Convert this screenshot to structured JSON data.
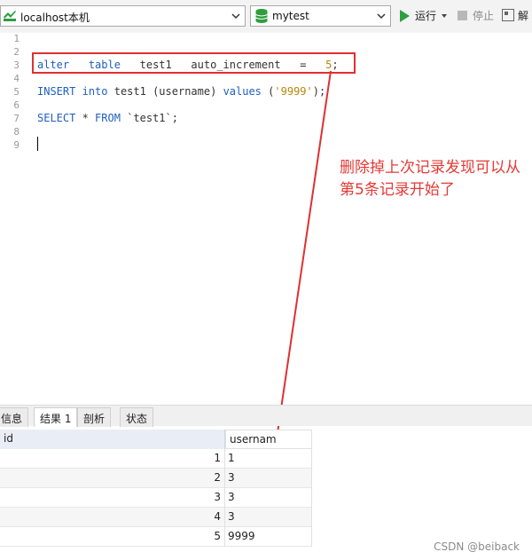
{
  "toolbar": {
    "connection": "localhost本机",
    "database": "mytest",
    "run_label": "运行",
    "stop_label": "停止",
    "explain_label": "解"
  },
  "editor": {
    "line_numbers": [
      "1",
      "2",
      "3",
      "4",
      "5",
      "6",
      "7",
      "8",
      "9"
    ],
    "lines": {
      "line3": {
        "kw1": "alter",
        "kw2": "table",
        "rest": "test1   auto_increment   =   ",
        "num": "5",
        "end": ";"
      },
      "line5": {
        "kw1": "INSERT",
        "kw2": "into",
        "mid": "test1 (username)",
        "kw3": "values",
        "open": "(",
        "str": "'9999'",
        "close": ");"
      },
      "line7": {
        "kw1": "SELECT",
        "mid": "* ",
        "kw2": "FROM",
        "rest": "`test1`;"
      }
    }
  },
  "annotation": {
    "text": "删除掉上次记录发现可以从第5条记录开始了",
    "color": "#e53935"
  },
  "result_tabs": [
    {
      "label": "信息"
    },
    {
      "label": "结果 1"
    },
    {
      "label": "剖析"
    },
    {
      "label": "状态"
    }
  ],
  "grid": {
    "columns": [
      "id",
      "usernam"
    ],
    "rows": [
      {
        "id": "1",
        "username": "1"
      },
      {
        "id": "2",
        "username": "3"
      },
      {
        "id": "3",
        "username": "3"
      },
      {
        "id": "4",
        "username": "3"
      },
      {
        "id": "5",
        "username": "9999"
      }
    ]
  },
  "watermark": "CSDN @beiback"
}
